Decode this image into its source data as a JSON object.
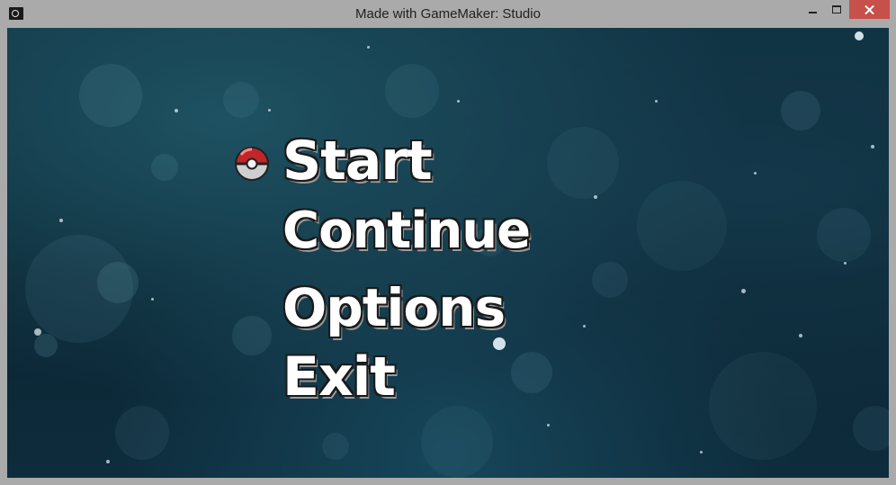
{
  "window": {
    "title": "Made with GameMaker: Studio",
    "icon": "gamemaker-icon",
    "controls": [
      "minimize-icon",
      "maximize-icon",
      "close-icon"
    ],
    "close_color": "#c7504a"
  },
  "menu": {
    "selected": "Start",
    "cursor_icon": "pokeball-icon",
    "items": [
      {
        "label": "Start"
      },
      {
        "label": "Continue"
      },
      {
        "label": "Options"
      },
      {
        "label": "Exit"
      }
    ]
  },
  "colors": {
    "background": "#0f3242",
    "menu_text": "#ffffff",
    "menu_outline": "#1a1a1a"
  }
}
